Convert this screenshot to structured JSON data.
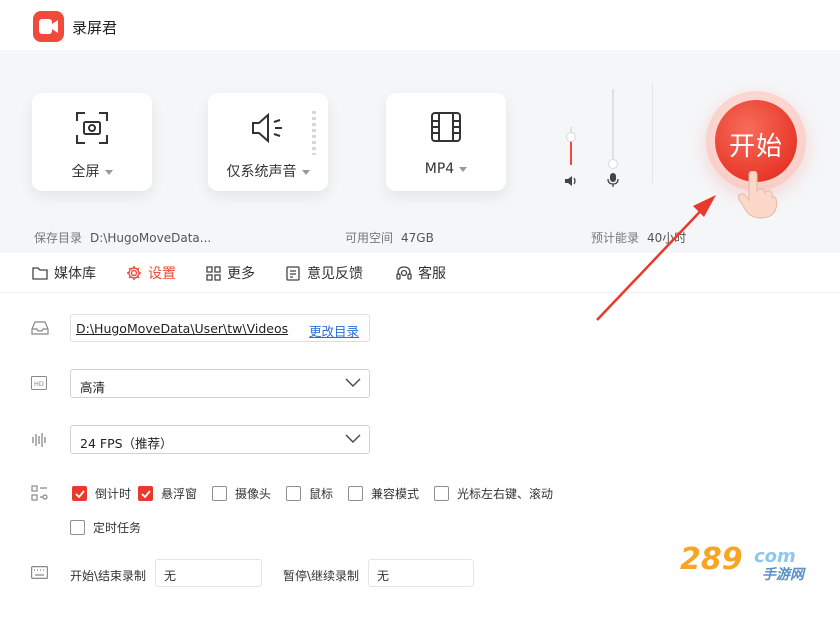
{
  "app": {
    "title": "录屏君"
  },
  "top": {
    "mode_label": "全屏",
    "audio_label": "仅系统声音",
    "format_label": "MP4",
    "start_label": "开始",
    "save_dir_label": "保存目录",
    "save_dir_value": "D:\\HugoMoveData...",
    "free_space_label": "可用空间",
    "free_space_value": "47GB",
    "estimate_label": "预计能录",
    "estimate_value": "40小时"
  },
  "tabs": [
    {
      "label": "媒体库",
      "icon": "folder-icon"
    },
    {
      "label": "设置",
      "icon": "gear-icon"
    },
    {
      "label": "更多",
      "icon": "grid-icon"
    },
    {
      "label": "意见反馈",
      "icon": "feedback-icon"
    },
    {
      "label": "客服",
      "icon": "headset-icon"
    }
  ],
  "settings": {
    "path_value": "D:\\HugoMoveData\\User\\tw\\Videos",
    "path_change": "更改目录",
    "quality_value": "高清",
    "fps_value": "24 FPS（推荐）",
    "options": [
      {
        "label": "倒计时",
        "checked": true
      },
      {
        "label": "悬浮窗",
        "checked": true
      },
      {
        "label": "摄像头",
        "checked": false
      },
      {
        "label": "鼠标",
        "checked": false
      },
      {
        "label": "兼容模式",
        "checked": false
      },
      {
        "label": "光标左右键、滚动",
        "checked": false
      },
      {
        "label": "定时任务",
        "checked": false
      }
    ],
    "hotkey_start_label": "开始\\结束录制",
    "hotkey_start_value": "无",
    "hotkey_pause_label": "暂停\\继续录制",
    "hotkey_pause_value": "无"
  },
  "colors": {
    "accent": "#f04a3a",
    "link": "#2a6fd6"
  },
  "watermark": {
    "text": "289",
    "suffix": "com",
    "sub": "手游网"
  }
}
